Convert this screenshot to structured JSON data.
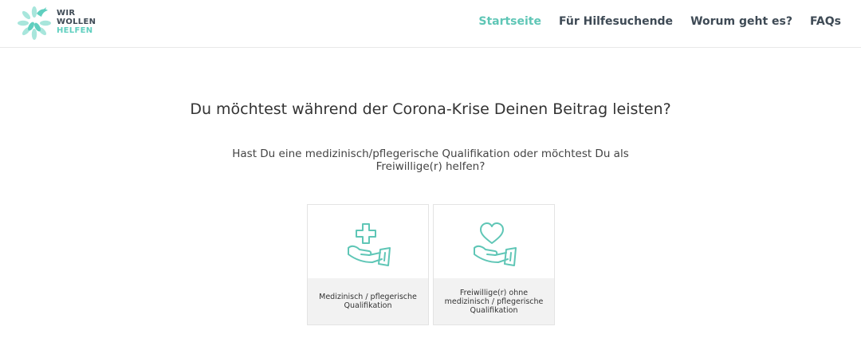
{
  "colors": {
    "accent": "#5fc6b6",
    "nav_text": "#3e4a55",
    "card_label_bg": "#f2f2f2"
  },
  "logo": {
    "line1": "WIR",
    "line2": "WOLLEN",
    "line3": "HELFEN",
    "icon": "dove-flower-logo"
  },
  "nav": {
    "items": [
      {
        "label": "Startseite",
        "active": true
      },
      {
        "label": "Für Hilfesuchende",
        "active": false
      },
      {
        "label": "Worum geht es?",
        "active": false
      },
      {
        "label": "FAQs",
        "active": false
      }
    ]
  },
  "main": {
    "headline": "Du möchtest während der Corona-Krise Deinen Beitrag leisten?",
    "subline_1": "Hast Du eine medizinisch/pflegerische Qualifikation oder möchtest Du als",
    "subline_2": "Freiwillige(r) helfen?",
    "options": [
      {
        "icon": "hand-with-cross-icon",
        "label": "Medizinisch / pflegerische Qualifikation"
      },
      {
        "icon": "hand-with-heart-icon",
        "label": "Freiwillige(r) ohne medizinisch / pflegerische Qualifikation"
      }
    ]
  }
}
